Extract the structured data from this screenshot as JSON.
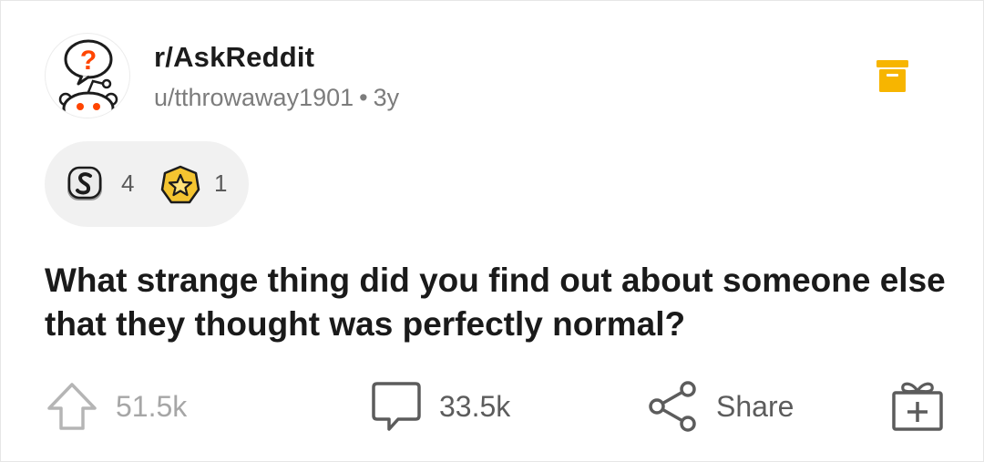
{
  "post": {
    "subreddit": "r/AskReddit",
    "author": "u/tthrowaway1901",
    "separator": "•",
    "age": "3y",
    "title": "What strange thing did you find out about someone else that they thought was perfectly normal?"
  },
  "awards": [
    {
      "icon": "silver-award-icon",
      "count": "4"
    },
    {
      "icon": "gold-star-award-icon",
      "count": "1"
    }
  ],
  "actions": {
    "upvotes": "51.5k",
    "comments": "33.5k",
    "share_label": "Share"
  },
  "colors": {
    "archive_icon": "#f7b500",
    "question_mark": "#ff4500",
    "award_gold": "#f4c430",
    "muted_text": "#7c7c7c"
  },
  "icons": {
    "avatar": "askreddit-avatar-icon",
    "archive": "archive-icon",
    "upvote": "upvote-arrow-icon",
    "comment": "comment-bubble-icon",
    "share": "share-icon",
    "gift": "gift-award-icon"
  }
}
